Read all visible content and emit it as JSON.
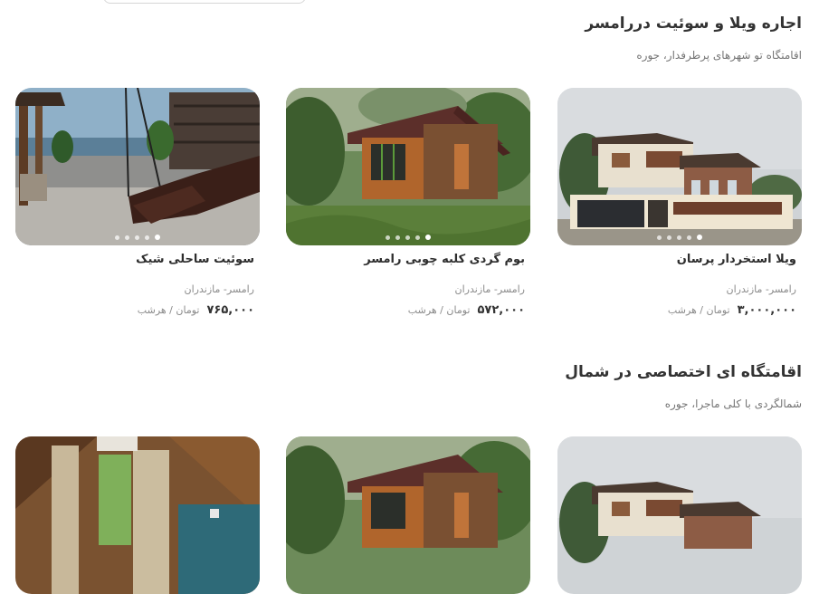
{
  "sections": [
    {
      "title": "اجاره ویلا و سوئیت دررامسر",
      "subtitle": "اقامتگاه تو شهرهای پرطرفدار، جوره",
      "cards": [
        {
          "title": "ویلا استخردار پرسان",
          "location": "رامسر- مازندران",
          "price": "۳,۰۰۰,۰۰۰",
          "unit": "تومان / هرشب",
          "image": "villa-photo"
        },
        {
          "title": "بوم گردی کلبه چوبی رامسر",
          "location": "رامسر- مازندران",
          "price": "۵۷۲,۰۰۰",
          "unit": "تومان / هرشب",
          "image": "wooden-cabin-photo"
        },
        {
          "title": "سوئیت ساحلی شیک",
          "location": "رامسر- مازندران",
          "price": "۷۶۵,۰۰۰",
          "unit": "تومان / هرشب",
          "image": "beach-terrace-photo"
        }
      ]
    },
    {
      "title": "اقامتگاه ای اختصاصی در شمال",
      "subtitle": "شمالگردی با کلی ماجرا، جوره",
      "cards": [
        {
          "image": "villa-photo"
        },
        {
          "image": "wooden-cabin-photo"
        },
        {
          "image": "a-frame-interior-photo"
        }
      ]
    }
  ],
  "colors": {
    "background": "#ffffff",
    "title": "#333333",
    "muted": "#8a8a8a"
  }
}
